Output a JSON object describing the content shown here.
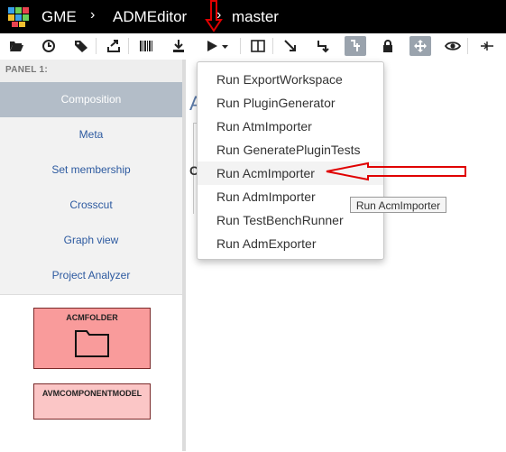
{
  "topbar": {
    "app_name": "GME",
    "project": "ADMEditor",
    "branch": "master"
  },
  "toolbar": {
    "icons": [
      "folder-open-icon",
      "history-icon",
      "tag-icon",
      "export-icon",
      "barcode-icon",
      "download-icon",
      "play-menu-icon",
      "split-panel-icon",
      "connect-icon",
      "connect-alt-icon",
      "set-icon",
      "lock-icon",
      "move-icon",
      "eye-icon",
      "split-line-icon"
    ]
  },
  "panel": {
    "title": "PANEL 1:",
    "tabs": [
      {
        "label": "Composition",
        "selected": true
      },
      {
        "label": "Meta"
      },
      {
        "label": "Set membership"
      },
      {
        "label": "Crosscut"
      },
      {
        "label": "Graph view"
      },
      {
        "label": "Project Analyzer"
      }
    ],
    "parts": [
      {
        "label": "ACMFOLDER",
        "icon": "folder-icon"
      },
      {
        "label": "AVMCOMPONENTMODEL"
      }
    ]
  },
  "canvas": {
    "title": "A",
    "glyph": "C"
  },
  "run_menu": {
    "items": [
      {
        "label": "Run ExportWorkspace"
      },
      {
        "label": "Run PluginGenerator"
      },
      {
        "label": "Run AtmImporter"
      },
      {
        "label": "Run GeneratePluginTests"
      },
      {
        "label": "Run AcmImporter",
        "hovered": true
      },
      {
        "label": "Run AdmImporter"
      },
      {
        "label": "Run TestBenchRunner"
      },
      {
        "label": "Run AdmExporter"
      }
    ]
  },
  "tooltip": {
    "text": "Run AcmImporter"
  },
  "colors": {
    "topbar_bg": "#000000",
    "tab_selected_bg": "#b3bdc8",
    "tab_text": "#2d5aa0",
    "part_fill": "#f99b9b",
    "annotation_arrow": "#e00000"
  }
}
